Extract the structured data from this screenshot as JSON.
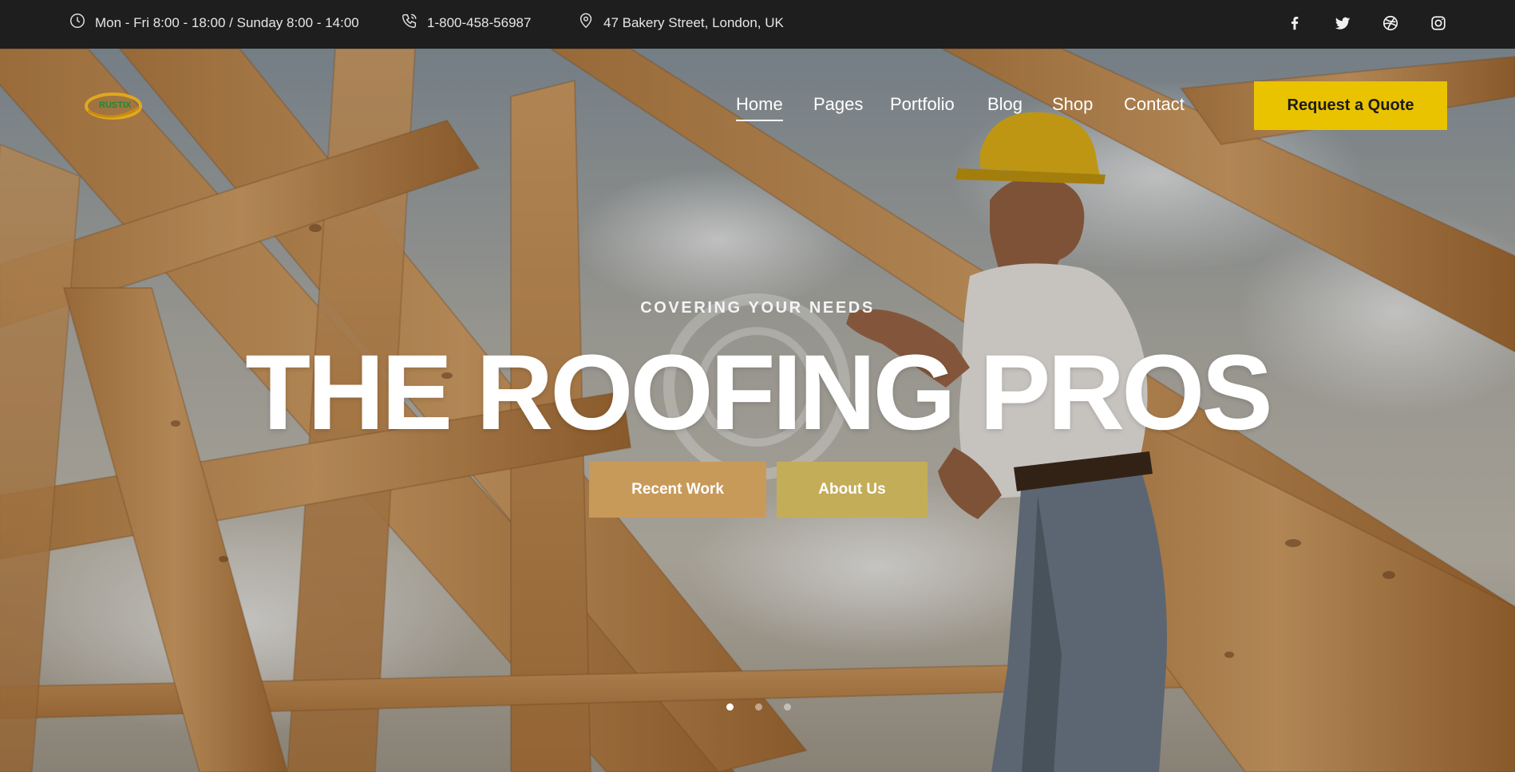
{
  "topbar": {
    "hours": "Mon - Fri 8:00 - 18:00 / Sunday 8:00 - 14:00",
    "phone": "1-800-458-56987",
    "address": "47 Bakery Street, London, UK",
    "icons": {
      "hours": "clock-icon",
      "phone": "phone-icon",
      "address": "map-pin-icon"
    },
    "social": [
      "facebook-icon",
      "twitter-icon",
      "dribbble-icon",
      "instagram-icon"
    ]
  },
  "logo": {
    "text": "RUSTIX",
    "colors": {
      "ring": "#e0a81c",
      "text": "#1f8a2c"
    }
  },
  "nav": {
    "items": [
      "Home",
      "Pages",
      "Portfolio",
      "Blog",
      "Shop",
      "Contact"
    ],
    "active": "Home"
  },
  "quote_button": {
    "label": "Request a Quote",
    "color": "#e9c300"
  },
  "hero": {
    "eyebrow": "COVERING YOUR NEEDS",
    "headline": "THE ROOFING PROS",
    "buttons": {
      "recent_work": {
        "label": "Recent Work",
        "color": "#c89a5a"
      },
      "about_us": {
        "label": "About Us",
        "color": "#c4ad58"
      }
    },
    "slider": {
      "slides": 3,
      "active_slide": 1
    }
  },
  "colors": {
    "topbar_bg": "#1e1e1e",
    "timber": "#c8945a",
    "accent": "#e9c300"
  }
}
